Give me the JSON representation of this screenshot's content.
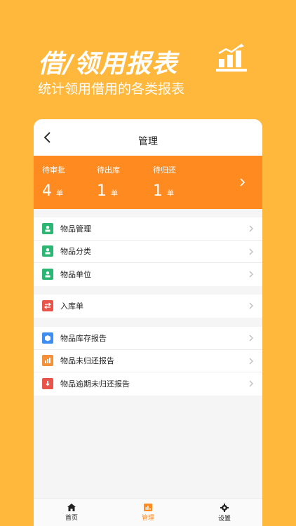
{
  "hero": {
    "title": "借/领用报表",
    "subtitle": "统计领用借用的各类报表"
  },
  "nav": {
    "title": "管理"
  },
  "stats": {
    "items": [
      {
        "label": "待审批",
        "value": "4",
        "unit": "单"
      },
      {
        "label": "待出库",
        "value": "1",
        "unit": "单"
      },
      {
        "label": "待归还",
        "value": "1",
        "unit": "单"
      }
    ]
  },
  "menu": {
    "group1": [
      {
        "label": "物品管理"
      },
      {
        "label": "物品分类"
      },
      {
        "label": "物品单位"
      }
    ],
    "group2": [
      {
        "label": "入库单"
      }
    ],
    "group3": [
      {
        "label": "物品库存报告"
      },
      {
        "label": "物品未归还报告"
      },
      {
        "label": "物品逾期未归还报告"
      }
    ]
  },
  "tabbar": {
    "tabs": [
      {
        "label": "首页",
        "icon": "home-icon"
      },
      {
        "label": "管理",
        "icon": "chart-icon"
      },
      {
        "label": "设置",
        "icon": "gear-icon"
      }
    ]
  },
  "colors": {
    "background": "#FFB73C",
    "accent": "#FF8A1F",
    "green": "#2BB673",
    "red": "#E8534A",
    "blue": "#3D8EF0",
    "orange": "#F4903A"
  }
}
